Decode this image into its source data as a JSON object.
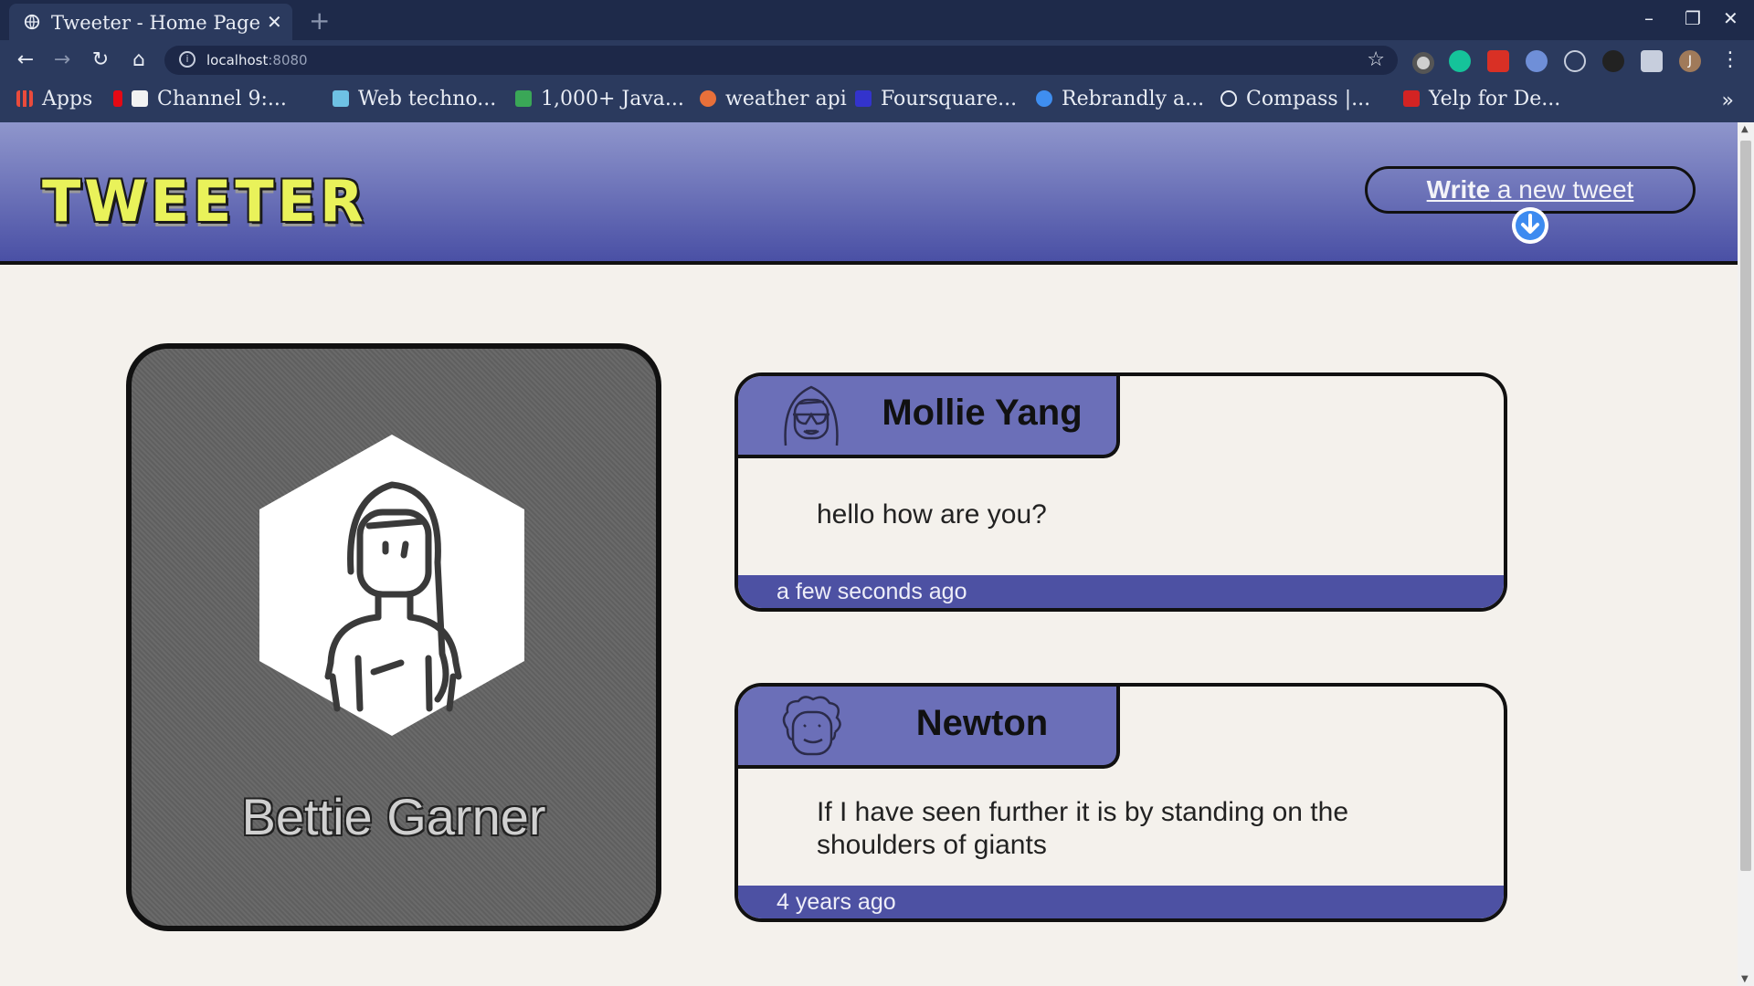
{
  "browser": {
    "tab_title": "Tweeter - Home Page",
    "tab_close": "✕",
    "new_tab": "+",
    "url_host": "localhost",
    "url_port": ":8080",
    "window_controls": {
      "minimize": "–",
      "maximize": "❐",
      "close": "✕"
    },
    "nav": {
      "back": "←",
      "forward": "→",
      "reload": "↻",
      "home": "⌂",
      "star": "☆",
      "menu": "⋮"
    },
    "profile_initial": "J",
    "bookmarks": [
      {
        "label": "Apps",
        "color": "#e94b3c"
      },
      {
        "label": "Channel 9:...",
        "color": "#f2f2f2"
      },
      {
        "label": "Web techno...",
        "color": "#6ec1e4"
      },
      {
        "label": "1,000+ Java...",
        "color": "#3aa757"
      },
      {
        "label": "weather api",
        "color": "#e8703a"
      },
      {
        "label": "Foursquare...",
        "color": "#3333cc"
      },
      {
        "label": "Rebrandly a...",
        "color": "#3f8ef0"
      },
      {
        "label": "Compass |...",
        "color": "#e8ecf4"
      },
      {
        "label": "Yelp for De...",
        "color": "#d32323"
      }
    ],
    "bookmarks_more": "»"
  },
  "header": {
    "logo": "TWEETER",
    "write_bold": "Write",
    "write_rest": " a new tweet",
    "accent_color": "#4a50a5"
  },
  "profile": {
    "name": "Bettie Garner"
  },
  "tweets": [
    {
      "author": "Mollie Yang",
      "text": "hello how are you?",
      "time": "a few seconds ago"
    },
    {
      "author": "Newton",
      "text": "If I have seen further it is by standing on the shoulders of giants",
      "time": "4 years ago"
    }
  ]
}
